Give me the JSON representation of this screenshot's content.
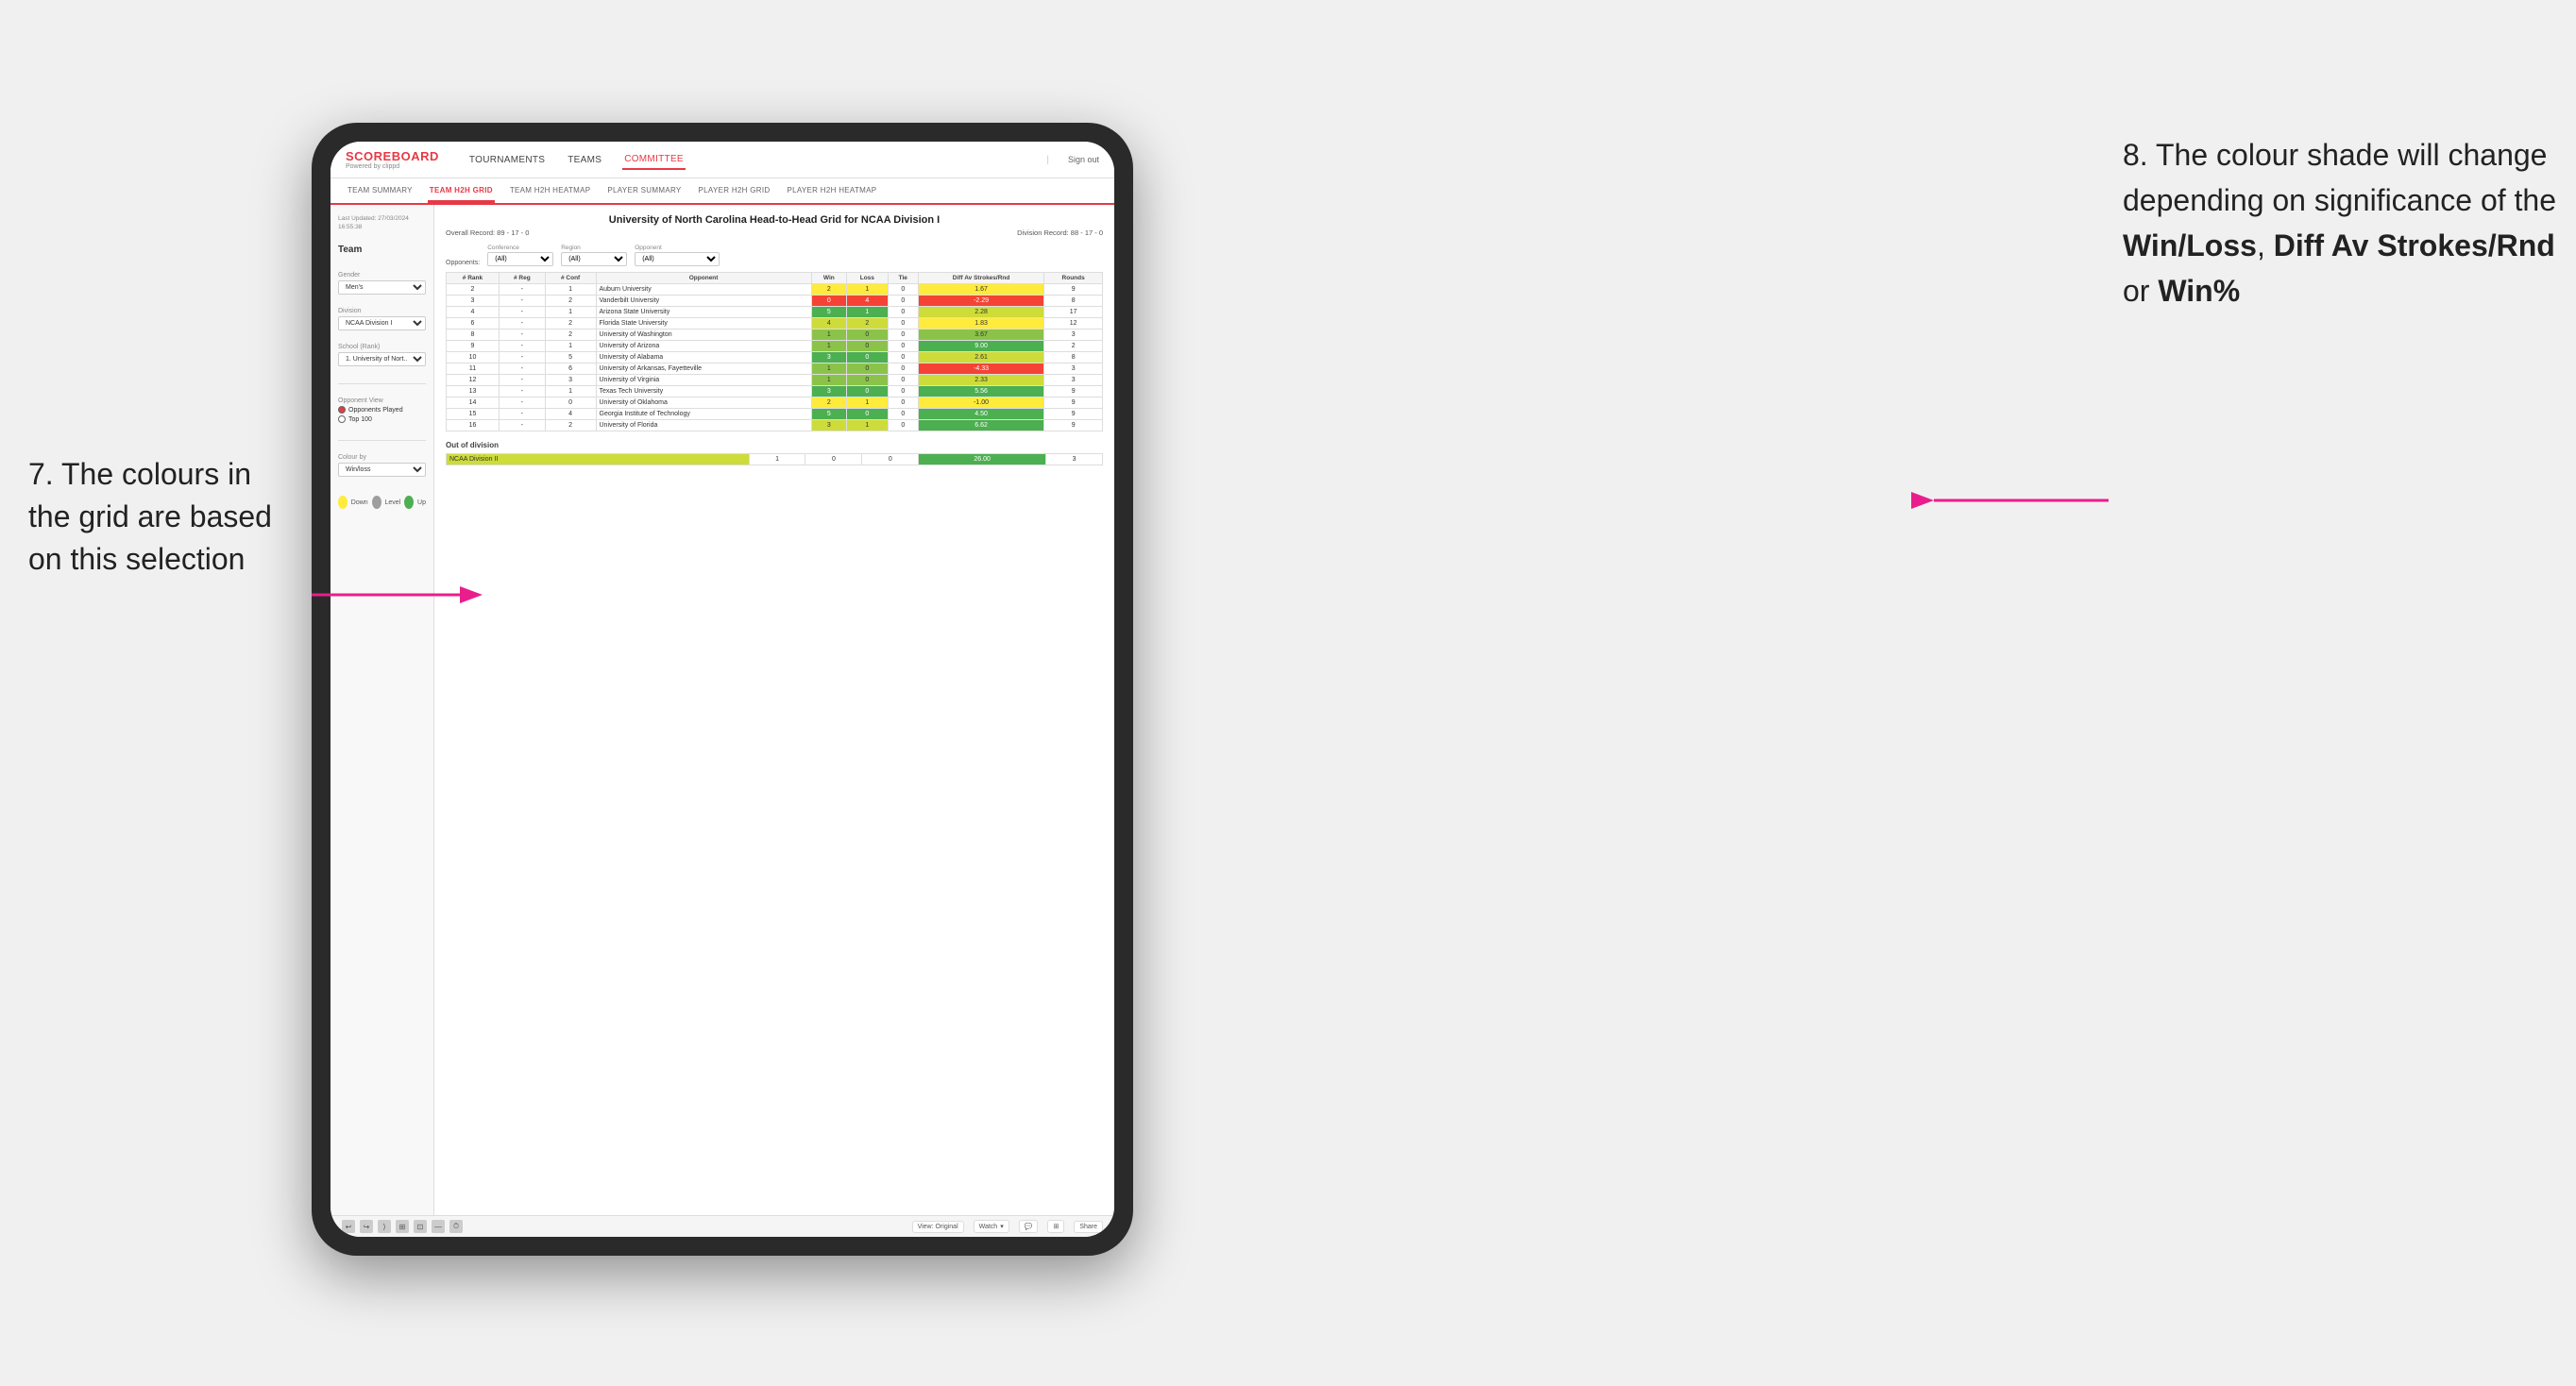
{
  "annotations": {
    "left": {
      "number": "7.",
      "text": "The colours in the grid are based on this selection"
    },
    "right": {
      "number": "8.",
      "text": "The colour shade will change depending on significance of the ",
      "bold1": "Win/Loss",
      "sep1": ", ",
      "bold2": "Diff Av Strokes/Rnd",
      "sep2": " or ",
      "bold3": "Win%"
    }
  },
  "nav": {
    "logo": "SCOREBOARD",
    "logo_sub": "Powered by clippd",
    "items": [
      "TOURNAMENTS",
      "TEAMS",
      "COMMITTEE"
    ],
    "active": "COMMITTEE",
    "sign_out": "Sign out"
  },
  "sub_nav": {
    "items": [
      "TEAM SUMMARY",
      "TEAM H2H GRID",
      "TEAM H2H HEATMAP",
      "PLAYER SUMMARY",
      "PLAYER H2H GRID",
      "PLAYER H2H HEATMAP"
    ],
    "active": "TEAM H2H GRID"
  },
  "sidebar": {
    "last_updated_label": "Last Updated: 27/03/2024",
    "last_updated_time": "16:55:38",
    "team_label": "Team",
    "gender_label": "Gender",
    "gender_value": "Men's",
    "division_label": "Division",
    "division_value": "NCAA Division I",
    "school_label": "School (Rank)",
    "school_value": "1. University of Nort...",
    "opponent_view_label": "Opponent View",
    "opponents_played": "Opponents Played",
    "top_100": "Top 100",
    "colour_by_label": "Colour by",
    "colour_by_value": "Win/loss",
    "legend": {
      "down": "Down",
      "level": "Level",
      "up": "Up"
    }
  },
  "grid": {
    "title": "University of North Carolina Head-to-Head Grid for NCAA Division I",
    "overall_record": "Overall Record: 89 - 17 - 0",
    "division_record": "Division Record: 88 - 17 - 0",
    "filters": {
      "conference_label": "Conference",
      "conference_value": "(All)",
      "region_label": "Region",
      "region_value": "(All)",
      "opponent_label": "Opponent",
      "opponent_value": "(All)",
      "opponents_label": "Opponents:"
    },
    "table_headers": [
      "#\nRank",
      "# Reg",
      "# Conf",
      "Opponent",
      "Win",
      "Loss",
      "Tie",
      "Diff Av Strokes/Rnd",
      "Rounds"
    ],
    "rows": [
      {
        "rank": "2",
        "reg": "-",
        "conf": "1",
        "opponent": "Auburn University",
        "win": "2",
        "loss": "1",
        "tie": "0",
        "diff": "1.67",
        "rounds": "9",
        "win_color": "yellow",
        "diff_color": "yellow"
      },
      {
        "rank": "3",
        "reg": "-",
        "conf": "2",
        "opponent": "Vanderbilt University",
        "win": "0",
        "loss": "4",
        "tie": "0",
        "diff": "-2.29",
        "rounds": "8",
        "win_color": "red",
        "diff_color": "red"
      },
      {
        "rank": "4",
        "reg": "-",
        "conf": "1",
        "opponent": "Arizona State University",
        "win": "5",
        "loss": "1",
        "tie": "0",
        "diff": "2.28",
        "rounds": "17",
        "win_color": "green_dark",
        "diff_color": "green_light"
      },
      {
        "rank": "6",
        "reg": "-",
        "conf": "2",
        "opponent": "Florida State University",
        "win": "4",
        "loss": "2",
        "tie": "0",
        "diff": "1.83",
        "rounds": "12",
        "win_color": "green_light",
        "diff_color": "yellow"
      },
      {
        "rank": "8",
        "reg": "-",
        "conf": "2",
        "opponent": "University of Washington",
        "win": "1",
        "loss": "0",
        "tie": "0",
        "diff": "3.67",
        "rounds": "3",
        "win_color": "green_mid",
        "diff_color": "green_mid"
      },
      {
        "rank": "9",
        "reg": "-",
        "conf": "1",
        "opponent": "University of Arizona",
        "win": "1",
        "loss": "0",
        "tie": "0",
        "diff": "9.00",
        "rounds": "2",
        "win_color": "green_mid",
        "diff_color": "green_dark"
      },
      {
        "rank": "10",
        "reg": "-",
        "conf": "5",
        "opponent": "University of Alabama",
        "win": "3",
        "loss": "0",
        "tie": "0",
        "diff": "2.61",
        "rounds": "8",
        "win_color": "green_dark",
        "diff_color": "green_light"
      },
      {
        "rank": "11",
        "reg": "-",
        "conf": "6",
        "opponent": "University of Arkansas, Fayetteville",
        "win": "1",
        "loss": "0",
        "tie": "0",
        "diff": "-4.33",
        "rounds": "3",
        "win_color": "green_mid",
        "diff_color": "red"
      },
      {
        "rank": "12",
        "reg": "-",
        "conf": "3",
        "opponent": "University of Virginia",
        "win": "1",
        "loss": "0",
        "tie": "0",
        "diff": "2.33",
        "rounds": "3",
        "win_color": "green_mid",
        "diff_color": "green_light"
      },
      {
        "rank": "13",
        "reg": "-",
        "conf": "1",
        "opponent": "Texas Tech University",
        "win": "3",
        "loss": "0",
        "tie": "0",
        "diff": "5.56",
        "rounds": "9",
        "win_color": "green_dark",
        "diff_color": "green_dark"
      },
      {
        "rank": "14",
        "reg": "-",
        "conf": "0",
        "opponent": "University of Oklahoma",
        "win": "2",
        "loss": "1",
        "tie": "0",
        "diff": "-1.00",
        "rounds": "9",
        "win_color": "yellow",
        "diff_color": "yellow"
      },
      {
        "rank": "15",
        "reg": "-",
        "conf": "4",
        "opponent": "Georgia Institute of Technology",
        "win": "5",
        "loss": "0",
        "tie": "0",
        "diff": "4.50",
        "rounds": "9",
        "win_color": "green_dark",
        "diff_color": "green_dark"
      },
      {
        "rank": "16",
        "reg": "-",
        "conf": "2",
        "opponent": "University of Florida",
        "win": "3",
        "loss": "1",
        "tie": "0",
        "diff": "6.62",
        "rounds": "9",
        "win_color": "green_light",
        "diff_color": "green_dark"
      }
    ],
    "out_of_division": {
      "title": "Out of division",
      "rows": [
        {
          "opponent": "NCAA Division II",
          "win": "1",
          "loss": "0",
          "tie": "0",
          "diff": "26.00",
          "rounds": "3",
          "diff_color": "green_dark"
        }
      ]
    }
  },
  "toolbar": {
    "view_label": "View: Original",
    "watch_label": "Watch",
    "share_label": "Share"
  }
}
